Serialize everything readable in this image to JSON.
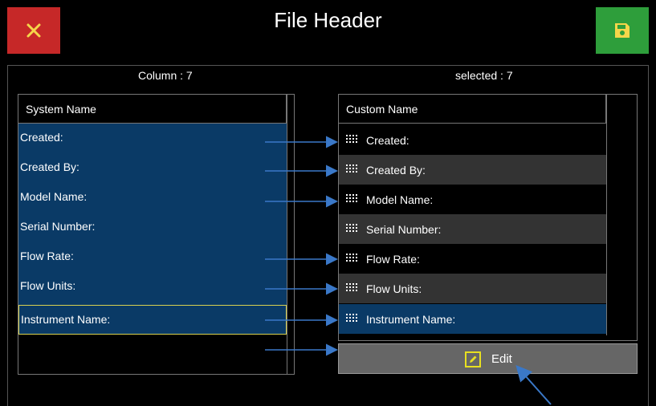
{
  "header": {
    "title": "File Header",
    "close_icon": "close-icon",
    "save_icon": "save-icon"
  },
  "counts": {
    "column_label": "Column : 7",
    "selected_label": "selected : 7"
  },
  "system_table": {
    "header": "System Name",
    "rows": [
      {
        "label": "Created:",
        "selected": false
      },
      {
        "label": "Created By:",
        "selected": false
      },
      {
        "label": "Model Name:",
        "selected": false
      },
      {
        "label": "Serial Number:",
        "selected": false
      },
      {
        "label": "Flow Rate:",
        "selected": false
      },
      {
        "label": "Flow Units:",
        "selected": false
      },
      {
        "label": "Instrument Name:",
        "selected": true
      }
    ]
  },
  "custom_table": {
    "header": "Custom Name",
    "rows": [
      {
        "label": "Created:",
        "selected": false
      },
      {
        "label": "Created By:",
        "selected": false
      },
      {
        "label": "Model Name:",
        "selected": false
      },
      {
        "label": "Serial Number:",
        "selected": false
      },
      {
        "label": "Flow Rate:",
        "selected": false
      },
      {
        "label": "Flow Units:",
        "selected": false
      },
      {
        "label": "Instrument Name:",
        "selected": true
      }
    ]
  },
  "edit_button": {
    "label": "Edit",
    "icon": "edit-icon"
  },
  "colors": {
    "close": "#c62828",
    "save": "#2e9e3b",
    "selection_blue": "#0a3a66",
    "arrow_blue": "#3a78c8",
    "edit_icon_yellow": "#e8e020"
  }
}
